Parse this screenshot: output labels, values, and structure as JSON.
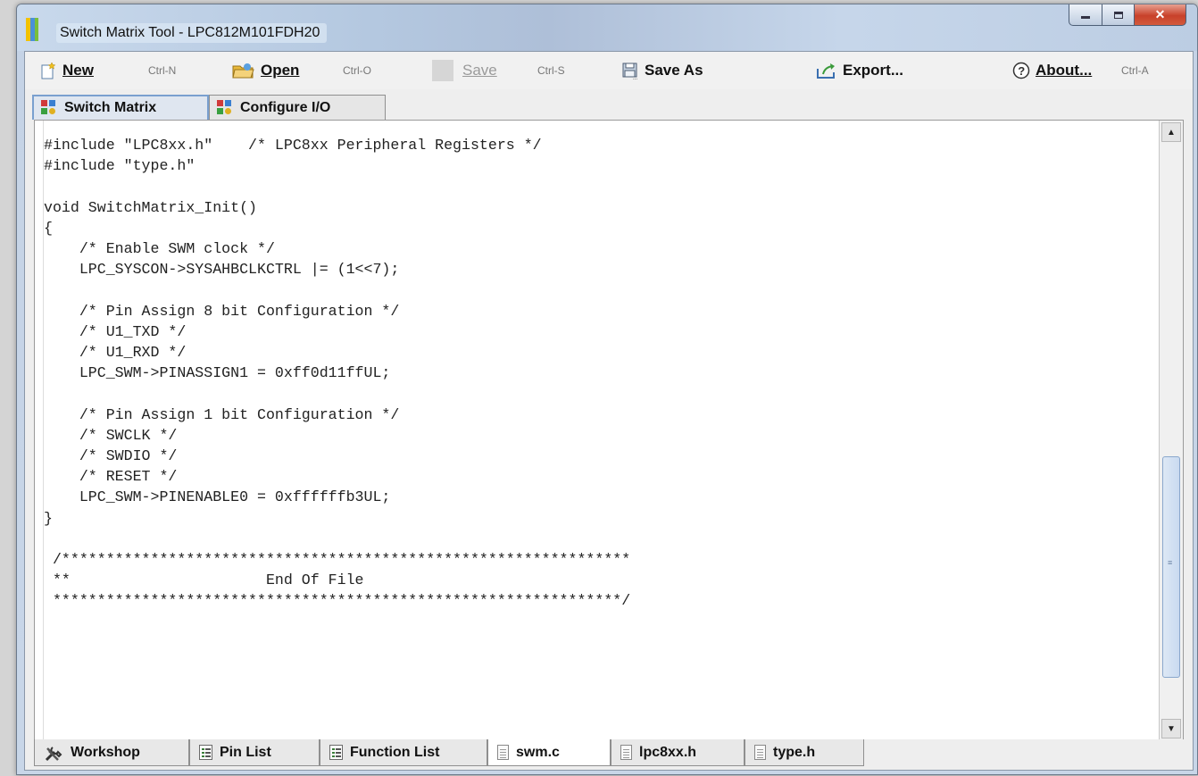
{
  "window": {
    "title": "Switch Matrix Tool - LPC812M101FDH20"
  },
  "toolbar": {
    "new": {
      "label": "New",
      "shortcut": "Ctrl-N"
    },
    "open": {
      "label": "Open",
      "shortcut": "Ctrl-O"
    },
    "save": {
      "label": "Save",
      "shortcut": "Ctrl-S"
    },
    "save_as": {
      "label": "Save As"
    },
    "export": {
      "label": "Export..."
    },
    "about": {
      "label": "About...",
      "shortcut": "Ctrl-A"
    }
  },
  "top_tabs": [
    {
      "label": "Switch Matrix",
      "active": true
    },
    {
      "label": "Configure I/O",
      "active": false
    }
  ],
  "editor": {
    "file": "swm.c",
    "lines": [
      "#include \"LPC8xx.h\"    /* LPC8xx Peripheral Registers */",
      "#include \"type.h\"",
      "",
      "void SwitchMatrix_Init()",
      "{",
      "    /* Enable SWM clock */",
      "    LPC_SYSCON->SYSAHBCLKCTRL |= (1<<7);",
      "",
      "    /* Pin Assign 8 bit Configuration */",
      "    /* U1_TXD */",
      "    /* U1_RXD */",
      "    LPC_SWM->PINASSIGN1 = 0xff0d11ffUL;",
      "",
      "    /* Pin Assign 1 bit Configuration */",
      "    /* SWCLK */",
      "    /* SWDIO */",
      "    /* RESET */",
      "    LPC_SWM->PINENABLE0 = 0xffffffb3UL;",
      "}",
      "",
      " /****************************************************************",
      " **                      End Of File",
      " ****************************************************************/"
    ]
  },
  "bottom_tabs": [
    {
      "label": "Workshop",
      "icon": "tools-icon",
      "active": false
    },
    {
      "label": "Pin List",
      "icon": "list-icon",
      "active": false
    },
    {
      "label": "Function List",
      "icon": "list-icon",
      "active": false
    },
    {
      "label": "swm.c",
      "icon": "document-icon",
      "active": true
    },
    {
      "label": "lpc8xx.h",
      "icon": "document-icon",
      "active": false
    },
    {
      "label": "type.h",
      "icon": "document-icon",
      "active": false
    }
  ],
  "colors": {
    "active_tab_border": "#7aa0cf",
    "close_button": "#c8412a",
    "editor_background": "#ffffff"
  }
}
